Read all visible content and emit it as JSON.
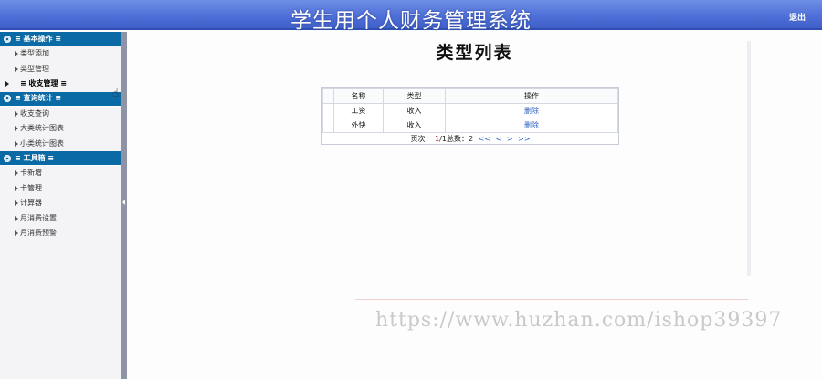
{
  "header": {
    "title": "学生用个人财务管理系统",
    "logout": "退出"
  },
  "sidebar": {
    "groups": [
      {
        "label": "≡ 基本操作 ≡",
        "items": [
          {
            "label": "类型添加"
          },
          {
            "label": "类型管理"
          }
        ]
      },
      {
        "label": "≡ 查询统计 ≡",
        "items": [
          {
            "label": "收支查询"
          },
          {
            "label": "大类统计图表"
          },
          {
            "label": "小类统计图表"
          }
        ]
      },
      {
        "label": "≡ 工具箱 ≡",
        "items": [
          {
            "label": "卡新增"
          },
          {
            "label": "卡管理"
          },
          {
            "label": "计算器"
          },
          {
            "label": "月消费设置"
          },
          {
            "label": "月消费预警"
          }
        ]
      }
    ],
    "active_item": {
      "label": "≡ 收支管理 ≡"
    }
  },
  "main": {
    "page_title": "类型列表",
    "table": {
      "headers": [
        "名称",
        "类型",
        "操作"
      ],
      "rows": [
        {
          "name": "工资",
          "type": "收入",
          "action": "删除"
        },
        {
          "name": "外快",
          "type": "收入",
          "action": "删除"
        }
      ]
    },
    "pager": {
      "page_label": "页次：",
      "current": "1",
      "total_pages": "/1",
      "total_label": "总数：",
      "total": "2",
      "first": "<<",
      "prev": "<",
      "next": ">",
      "last": ">>"
    }
  },
  "watermark": "https://www.huzhan.com/ishop39397",
  "colors": {
    "header": "#4f70d8",
    "sidebar_group": "#0a6aa6",
    "link": "#2a5fc0",
    "current_page": "#c00000"
  }
}
